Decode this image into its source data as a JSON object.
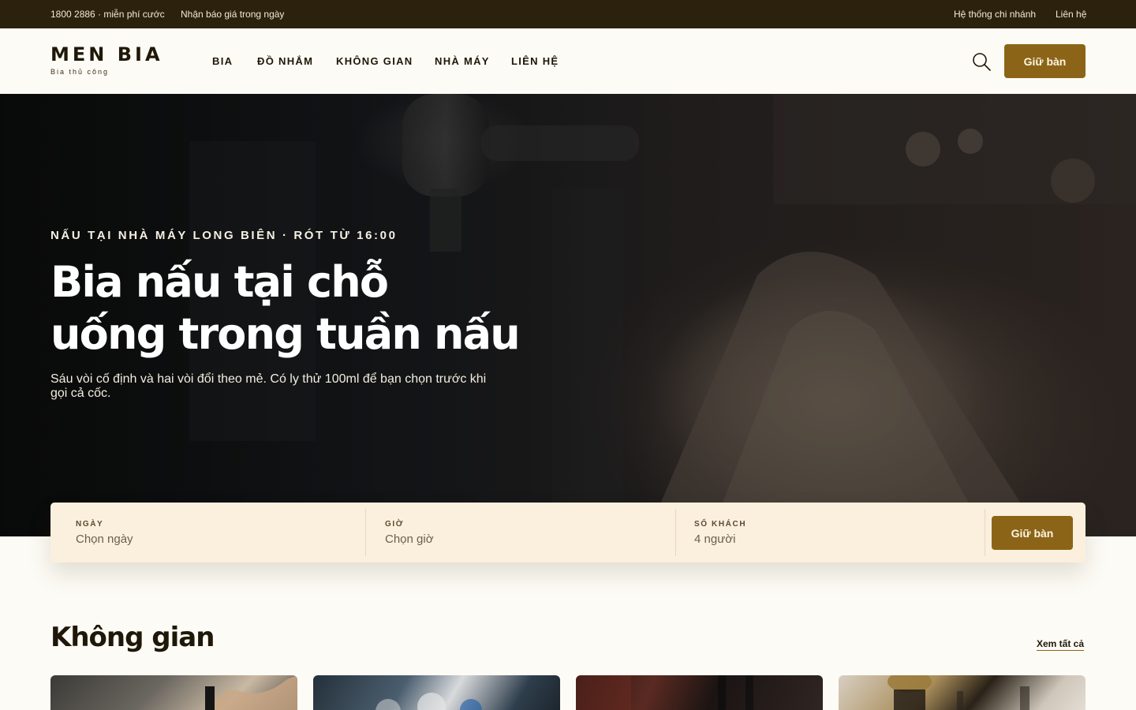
{
  "topbar": {
    "phone": "1800 2886 · miễn phí cước",
    "quote": "Nhận báo giá trong ngày",
    "branches": "Hệ thống chi nhánh",
    "contact": "Liên hệ"
  },
  "header": {
    "logo": "MEN BIA",
    "tagline": "Bia thủ công",
    "nav": [
      "BIA",
      "ĐỒ NHẮM",
      "KHÔNG GIAN",
      "NHÀ MÁY",
      "LIÊN HỆ"
    ],
    "search_icon": "search-icon",
    "cta": "Giữ bàn"
  },
  "hero": {
    "eyebrow": "NẤU TẠI NHÀ MÁY LONG BIÊN · RÓT TỪ 16:00",
    "title_line1": "Bia nấu tại chỗ",
    "title_line2": "uống trong tuần nấu",
    "description": "Sáu vòi cố định và hai vòi đổi theo mẻ. Có ly thử 100ml để bạn chọn trước khi gọi cả cốc."
  },
  "booking": {
    "date": {
      "label": "NGÀY",
      "value": "Chọn ngày"
    },
    "time": {
      "label": "GIỜ",
      "value": "Chọn giờ"
    },
    "guests": {
      "label": "SỐ KHÁCH",
      "value": "4 người"
    },
    "cta": "Giữ bàn"
  },
  "section": {
    "title": "Không gian",
    "see_all": "Xem tất cả"
  },
  "colors": {
    "topbar_bg": "#2b210c",
    "accent": "#8c6418",
    "page_bg": "#fdfbf5",
    "booking_bg": "#faf0dd"
  }
}
